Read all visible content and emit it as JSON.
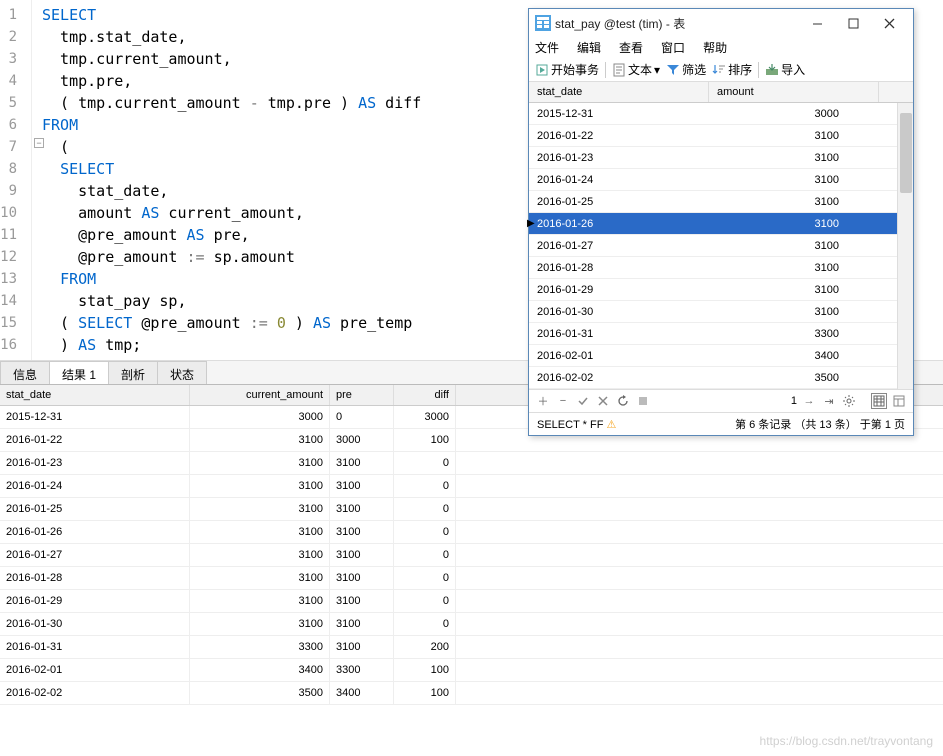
{
  "code": {
    "lines": [
      {
        "n": "1",
        "indent": 0,
        "tokens": [
          {
            "t": "SELECT",
            "c": "kw"
          }
        ]
      },
      {
        "n": "2",
        "indent": 1,
        "tokens": [
          {
            "t": "tmp.stat_date,",
            "c": ""
          }
        ]
      },
      {
        "n": "3",
        "indent": 1,
        "tokens": [
          {
            "t": "tmp.current_amount,",
            "c": ""
          }
        ]
      },
      {
        "n": "4",
        "indent": 1,
        "tokens": [
          {
            "t": "tmp.pre,",
            "c": ""
          }
        ]
      },
      {
        "n": "5",
        "indent": 1,
        "tokens": [
          {
            "t": "( tmp.current_amount ",
            "c": ""
          },
          {
            "t": "-",
            "c": "op"
          },
          {
            "t": " tmp.pre ) ",
            "c": ""
          },
          {
            "t": "AS",
            "c": "kw"
          },
          {
            "t": " diff ",
            "c": ""
          }
        ]
      },
      {
        "n": "6",
        "indent": 0,
        "tokens": [
          {
            "t": "FROM",
            "c": "kw"
          }
        ]
      },
      {
        "n": "7",
        "indent": 1,
        "tokens": [
          {
            "t": "(",
            "c": ""
          }
        ]
      },
      {
        "n": "8",
        "indent": 1,
        "tokens": [
          {
            "t": "SELECT",
            "c": "kw"
          }
        ]
      },
      {
        "n": "9",
        "indent": 2,
        "tokens": [
          {
            "t": "stat_date,",
            "c": ""
          }
        ]
      },
      {
        "n": "10",
        "indent": 2,
        "tokens": [
          {
            "t": "amount ",
            "c": ""
          },
          {
            "t": "AS",
            "c": "kw"
          },
          {
            "t": " current_amount,",
            "c": ""
          }
        ]
      },
      {
        "n": "11",
        "indent": 2,
        "tokens": [
          {
            "t": "@pre_amount ",
            "c": ""
          },
          {
            "t": "AS",
            "c": "kw"
          },
          {
            "t": " pre,",
            "c": ""
          }
        ]
      },
      {
        "n": "12",
        "indent": 2,
        "tokens": [
          {
            "t": "@pre_amount ",
            "c": ""
          },
          {
            "t": ":=",
            "c": "op"
          },
          {
            "t": " sp.amount",
            "c": ""
          }
        ]
      },
      {
        "n": "13",
        "indent": 1,
        "tokens": [
          {
            "t": "FROM",
            "c": "kw"
          }
        ]
      },
      {
        "n": "14",
        "indent": 2,
        "tokens": [
          {
            "t": "stat_pay sp,",
            "c": ""
          }
        ]
      },
      {
        "n": "15",
        "indent": 1,
        "tokens": [
          {
            "t": "( ",
            "c": ""
          },
          {
            "t": "SELECT",
            "c": "kw"
          },
          {
            "t": " @pre_amount ",
            "c": ""
          },
          {
            "t": ":=",
            "c": "op"
          },
          {
            "t": " ",
            "c": ""
          },
          {
            "t": "0",
            "c": "lit"
          },
          {
            "t": " ) ",
            "c": ""
          },
          {
            "t": "AS",
            "c": "kw"
          },
          {
            "t": " pre_temp",
            "c": ""
          }
        ]
      },
      {
        "n": "16",
        "indent": 1,
        "tokens": [
          {
            "t": ") ",
            "c": ""
          },
          {
            "t": "AS",
            "c": "kw"
          },
          {
            "t": " tmp;",
            "c": ""
          }
        ]
      }
    ]
  },
  "tabs": {
    "items": [
      "信息",
      "结果 1",
      "剖析",
      "状态"
    ],
    "active": 1
  },
  "result": {
    "columns": [
      "stat_date",
      "current_amount",
      "pre",
      "diff"
    ],
    "rows": [
      [
        "2015-12-31",
        "3000",
        "0",
        "3000"
      ],
      [
        "2016-01-22",
        "3100",
        "3000",
        "100"
      ],
      [
        "2016-01-23",
        "3100",
        "3100",
        "0"
      ],
      [
        "2016-01-24",
        "3100",
        "3100",
        "0"
      ],
      [
        "2016-01-25",
        "3100",
        "3100",
        "0"
      ],
      [
        "2016-01-26",
        "3100",
        "3100",
        "0"
      ],
      [
        "2016-01-27",
        "3100",
        "3100",
        "0"
      ],
      [
        "2016-01-28",
        "3100",
        "3100",
        "0"
      ],
      [
        "2016-01-29",
        "3100",
        "3100",
        "0"
      ],
      [
        "2016-01-30",
        "3100",
        "3100",
        "0"
      ],
      [
        "2016-01-31",
        "3300",
        "3100",
        "200"
      ],
      [
        "2016-02-01",
        "3400",
        "3300",
        "100"
      ],
      [
        "2016-02-02",
        "3500",
        "3400",
        "100"
      ]
    ]
  },
  "popup": {
    "title": "stat_pay @test (tim) - 表",
    "menus": [
      "文件",
      "编辑",
      "查看",
      "窗口",
      "帮助"
    ],
    "toolbar": {
      "begin": "开始事务",
      "text": "文本",
      "filter": "筛选",
      "sort": "排序",
      "import": "导入"
    },
    "columns": [
      "stat_date",
      "amount"
    ],
    "rows": [
      [
        "2015-12-31",
        "3000"
      ],
      [
        "2016-01-22",
        "3100"
      ],
      [
        "2016-01-23",
        "3100"
      ],
      [
        "2016-01-24",
        "3100"
      ],
      [
        "2016-01-25",
        "3100"
      ],
      [
        "2016-01-26",
        "3100"
      ],
      [
        "2016-01-27",
        "3100"
      ],
      [
        "2016-01-28",
        "3100"
      ],
      [
        "2016-01-29",
        "3100"
      ],
      [
        "2016-01-30",
        "3100"
      ],
      [
        "2016-01-31",
        "3300"
      ],
      [
        "2016-02-01",
        "3400"
      ],
      [
        "2016-02-02",
        "3500"
      ]
    ],
    "selected": 5,
    "status_page": "1",
    "status_query": "SELECT * FF",
    "status_right": "第 6 条记录 （共 13 条） 于第 1 页"
  },
  "watermark": "https://blog.csdn.net/trayvontang"
}
